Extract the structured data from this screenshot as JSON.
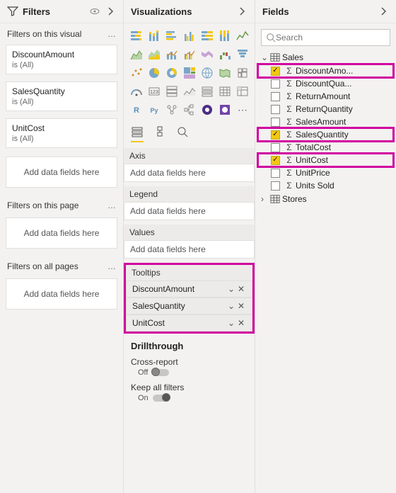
{
  "filters": {
    "title": "Filters",
    "sections": {
      "visual": {
        "label": "Filters on this visual",
        "cards": [
          {
            "name": "DiscountAmount",
            "value": "is (All)"
          },
          {
            "name": "SalesQuantity",
            "value": "is (All)"
          },
          {
            "name": "UnitCost",
            "value": "is (All)"
          }
        ],
        "add": "Add data fields here"
      },
      "page": {
        "label": "Filters on this page",
        "add": "Add data fields here"
      },
      "all": {
        "label": "Filters on all pages",
        "add": "Add data fields here"
      }
    }
  },
  "viz": {
    "title": "Visualizations",
    "buckets": {
      "axis": {
        "label": "Axis",
        "placeholder": "Add data fields here"
      },
      "legend": {
        "label": "Legend",
        "placeholder": "Add data fields here"
      },
      "values": {
        "label": "Values",
        "placeholder": "Add data fields here"
      },
      "tooltips": {
        "label": "Tooltips",
        "items": [
          "DiscountAmount",
          "SalesQuantity",
          "UnitCost"
        ]
      }
    },
    "drill": {
      "title": "Drillthrough",
      "cross": "Cross-report",
      "cross_state": "Off",
      "keep": "Keep all filters",
      "keep_state": "On"
    }
  },
  "fields": {
    "title": "Fields",
    "search_placeholder": "Search",
    "tables": [
      {
        "name": "Sales",
        "expanded": true,
        "fields": [
          {
            "name": "DiscountAmo...",
            "checked": true,
            "highlight": true
          },
          {
            "name": "DiscountQua...",
            "checked": false
          },
          {
            "name": "ReturnAmount",
            "checked": false
          },
          {
            "name": "ReturnQuantity",
            "checked": false
          },
          {
            "name": "SalesAmount",
            "checked": false
          },
          {
            "name": "SalesQuantity",
            "checked": true,
            "highlight": true
          },
          {
            "name": "TotalCost",
            "checked": false
          },
          {
            "name": "UnitCost",
            "checked": true,
            "highlight": true
          },
          {
            "name": "UnitPrice",
            "checked": false
          },
          {
            "name": "Units Sold",
            "checked": false
          }
        ]
      },
      {
        "name": "Stores",
        "expanded": false
      }
    ]
  }
}
